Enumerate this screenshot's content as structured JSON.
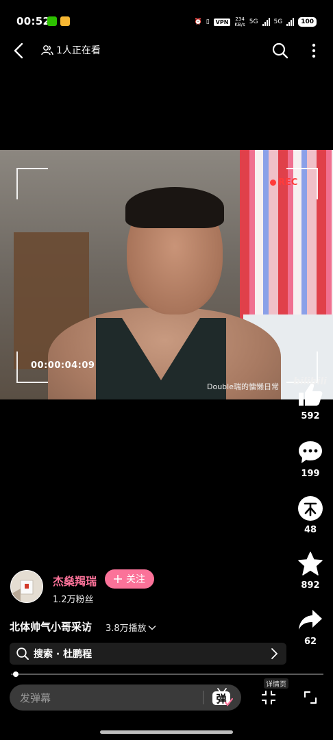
{
  "status_bar": {
    "time": "00:52",
    "vpn": "VPN",
    "speed_value": "234",
    "speed_unit": "KB/s",
    "net1": "5G",
    "net2": "5G",
    "battery": "100"
  },
  "header": {
    "viewers": "1人正在看"
  },
  "video": {
    "rec": "REC",
    "timer": "00:00:04:09",
    "watermark": "Double瑞的慵懒日常",
    "platform": "bilibili"
  },
  "actions": {
    "like_count": "592",
    "comment_count": "199",
    "coin_count": "48",
    "favorite_count": "892",
    "share_count": "62"
  },
  "author": {
    "name": "杰燊羯瑞",
    "follow_label": "关注",
    "followers": "1.2万粉丝"
  },
  "video_info": {
    "title": "北体帅气小哥采访",
    "plays": "3.8万播放"
  },
  "search_bar": {
    "text": "搜索 · 杜鹏程"
  },
  "bottom_bar": {
    "danmaku_placeholder": "发弹幕",
    "danmaku_toggle": "弹",
    "details_label": "详情页"
  },
  "colors": {
    "accent": "#fb7299",
    "background": "#000000",
    "rec": "#ff3b3b"
  },
  "playback": {
    "progress_fraction": 0.01
  }
}
